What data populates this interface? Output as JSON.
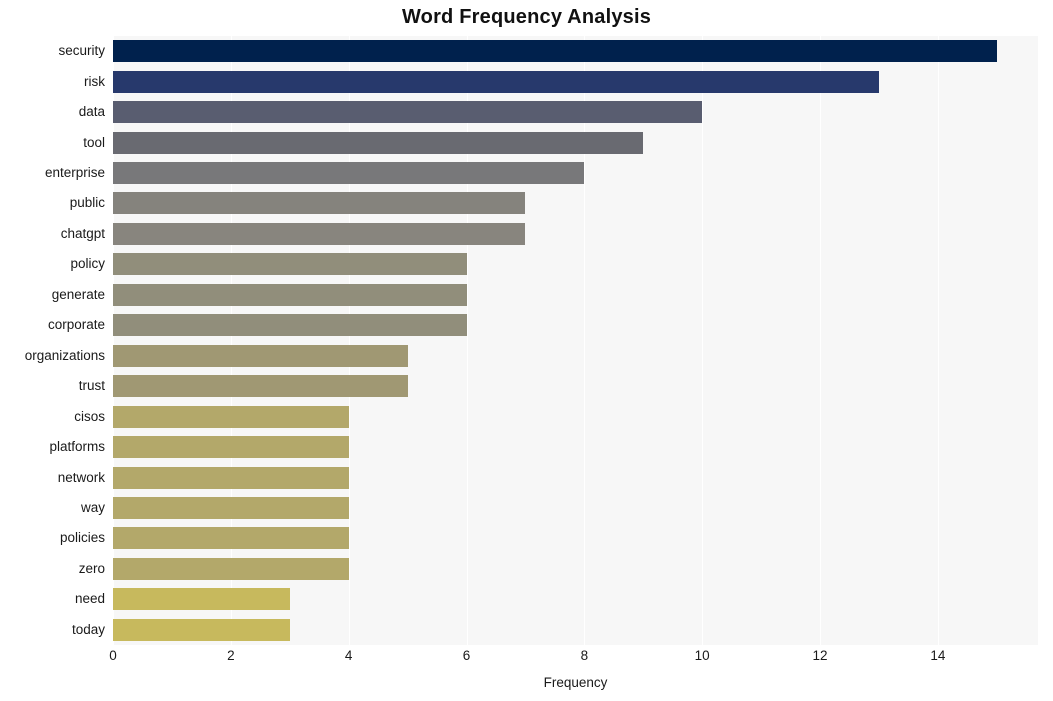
{
  "chart_data": {
    "type": "bar",
    "orientation": "horizontal",
    "title": "Word Frequency Analysis",
    "xlabel": "Frequency",
    "ylabel": "",
    "xlim": [
      0,
      15.7
    ],
    "ylim": [
      0,
      20
    ],
    "grid": true,
    "legend": null,
    "xticks": [
      "0",
      "2",
      "4",
      "6",
      "8",
      "10",
      "12",
      "14"
    ],
    "xtick_values": [
      0,
      2,
      4,
      6,
      8,
      10,
      12,
      14
    ],
    "categories": [
      "security",
      "risk",
      "data",
      "tool",
      "enterprise",
      "public",
      "chatgpt",
      "policy",
      "generate",
      "corporate",
      "organizations",
      "trust",
      "cisos",
      "platforms",
      "network",
      "way",
      "policies",
      "zero",
      "need",
      "today"
    ],
    "values": [
      15,
      13,
      10,
      9,
      8,
      7,
      7,
      6,
      6,
      6,
      5,
      5,
      4,
      4,
      4,
      4,
      4,
      4,
      3,
      3
    ],
    "bar_colors": [
      "#00214d",
      "#233b६e",
      "#595d70",
      "#6a6b72",
      "#77777a",
      "#85837e",
      "#88857f",
      "#908d7c",
      "#918e7c",
      "#918e7c",
      "#a49c72",
      "#a49c72",
      "#b2a766",
      "#b2a766",
      "#b2a766",
      "#b2a766",
      "#b2a766",
      "#b2a766",
      "#c6b85c",
      "#c6b85c"
    ],
    "bars": [
      {
        "label": "security",
        "value": 15,
        "color": "#00214d"
      },
      {
        "label": "risk",
        "value": 13,
        "color": "#27396c"
      },
      {
        "label": "data",
        "value": 10,
        "color": "#595d70"
      },
      {
        "label": "tool",
        "value": 9,
        "color": "#696a71"
      },
      {
        "label": "enterprise",
        "value": 8,
        "color": "#78787a"
      },
      {
        "label": "public",
        "value": 7,
        "color": "#85837d"
      },
      {
        "label": "chatgpt",
        "value": 7,
        "color": "#88857e"
      },
      {
        "label": "policy",
        "value": 6,
        "color": "#918e7b"
      },
      {
        "label": "generate",
        "value": 6,
        "color": "#918e7b"
      },
      {
        "label": "corporate",
        "value": 6,
        "color": "#918e7b"
      },
      {
        "label": "organizations",
        "value": 5,
        "color": "#a09873"
      },
      {
        "label": "trust",
        "value": 5,
        "color": "#a09873"
      },
      {
        "label": "cisos",
        "value": 4,
        "color": "#b3a86a"
      },
      {
        "label": "platforms",
        "value": 4,
        "color": "#b3a86a"
      },
      {
        "label": "network",
        "value": 4,
        "color": "#b3a86a"
      },
      {
        "label": "way",
        "value": 4,
        "color": "#b3a86a"
      },
      {
        "label": "policies",
        "value": 4,
        "color": "#b3a86a"
      },
      {
        "label": "zero",
        "value": 4,
        "color": "#b3a86a"
      },
      {
        "label": "need",
        "value": 3,
        "color": "#c7b95d"
      },
      {
        "label": "today",
        "value": 3,
        "color": "#c7b95d"
      }
    ],
    "style": {
      "plot_background": "#f7f7f7",
      "figure_background": "#ffffff",
      "gridline_color": "#ffffff",
      "text_color": "#1a1a1a",
      "title_color": "#111111"
    }
  }
}
